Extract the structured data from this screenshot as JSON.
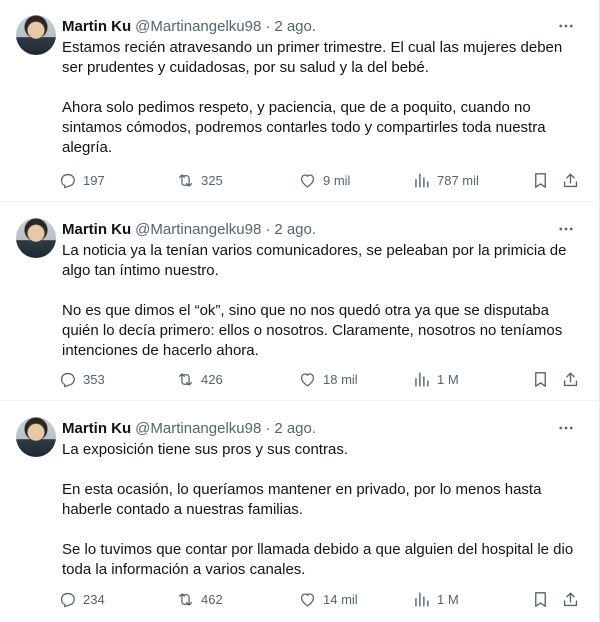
{
  "tweets": [
    {
      "name": "Martin Ku",
      "handle": "@Martinangelku98",
      "separator": "·",
      "date": "2 ago.",
      "paragraphs": [
        "Estamos recién atravesando un primer trimestre. El cual las mujeres deben ser prudentes y cuidadosas, por su salud y la del bebé.",
        "Ahora solo pedimos respeto, y paciencia, que de a poquito, cuando no sintamos cómodos, podremos contarles todo y compartirles toda nuestra alegría."
      ],
      "replies": "197",
      "retweets": "325",
      "likes": "9 mil",
      "views": "787 mil"
    },
    {
      "name": "Martin Ku",
      "handle": "@Martinangelku98",
      "separator": "·",
      "date": "2 ago.",
      "paragraphs": [
        "La noticia ya la tenían varios comunicadores, se peleaban por la primicia de algo tan íntimo nuestro.",
        "No es que dimos el “ok”, sino que no nos quedó otra ya que se disputaba quién lo decía primero: ellos o nosotros. Claramente, nosotros no teníamos intenciones de hacerlo ahora."
      ],
      "replies": "353",
      "retweets": "426",
      "likes": "18 mil",
      "views": "1 M"
    },
    {
      "name": "Martin Ku",
      "handle": "@Martinangelku98",
      "separator": "·",
      "date": "2 ago.",
      "paragraphs": [
        "La exposición tiene sus pros y sus contras.",
        "En esta ocasión, lo queríamos mantener en privado, por lo menos hasta haberle contado a nuestras familias.",
        "Se lo tuvimos que contar por llamada debido a que alguien del hospital le dio toda la información a varios canales."
      ],
      "replies": "234",
      "retweets": "462",
      "likes": "14 mil",
      "views": "1 M"
    }
  ],
  "icons": {
    "reply": "reply-icon",
    "retweet": "retweet-icon",
    "like": "heart-icon",
    "views": "views-icon",
    "bookmark": "bookmark-icon",
    "share": "share-icon",
    "more": "more-icon"
  },
  "colors": {
    "text": "#0f1419",
    "secondary": "#536471",
    "divider": "#eff3f4"
  }
}
